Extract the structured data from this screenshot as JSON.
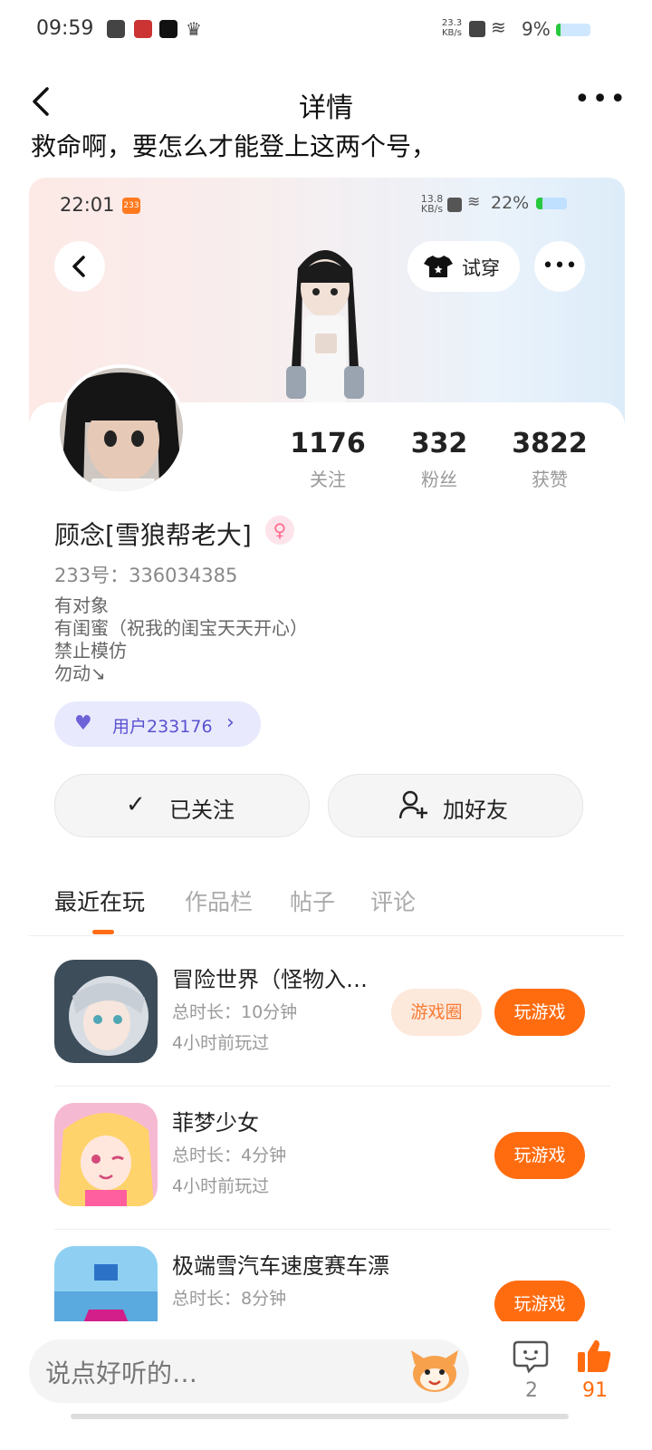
{
  "status_bar": {
    "time": "09:59",
    "net_speed": "23.3 KB/s",
    "battery": "9%"
  },
  "nav": {
    "title": "详情",
    "more_label": "•••"
  },
  "post": {
    "text_cut": "救命啊，要怎么才能登上这两个号，"
  },
  "screenshot": {
    "status": {
      "time": "22:01",
      "badge": "233",
      "speed": "13.8 KB/s",
      "battery": "22%"
    },
    "try_on_label": "试穿",
    "profile": {
      "name": "顾念[雪狼帮老大]",
      "gender_symbol": "♀",
      "uid_text": "233号：336034385",
      "bio_lines": [
        "有对象",
        "有闺蜜（祝我的闺宝天天开心）",
        "禁止模仿",
        "勿动↘"
      ],
      "stats": [
        {
          "value": "1176",
          "label": "关注"
        },
        {
          "value": "332",
          "label": "粉丝"
        },
        {
          "value": "3822",
          "label": "获赞"
        }
      ],
      "user_chip": "用户233176"
    },
    "buttons": {
      "followed": "已关注",
      "add_friend": "加好友"
    },
    "tabs": [
      "最近在玩",
      "作品栏",
      "帖子",
      "评论"
    ],
    "games": [
      {
        "name": "冒险世界（怪物入…",
        "duration": "总时长：10分钟",
        "last_played": "4小时前玩过",
        "circle_btn": "游戏圈",
        "play_btn": "玩游戏"
      },
      {
        "name": "菲梦少女",
        "duration": "总时长：4分钟",
        "last_played": "4小时前玩过",
        "play_btn": "玩游戏"
      },
      {
        "name": "极端雪汽车速度赛车漂移",
        "duration": "总时长：8分钟",
        "last_played": "",
        "play_btn": "玩游戏"
      }
    ]
  },
  "bottom": {
    "placeholder": "说点好听的…",
    "comment_count": "2",
    "like_count": "91"
  }
}
